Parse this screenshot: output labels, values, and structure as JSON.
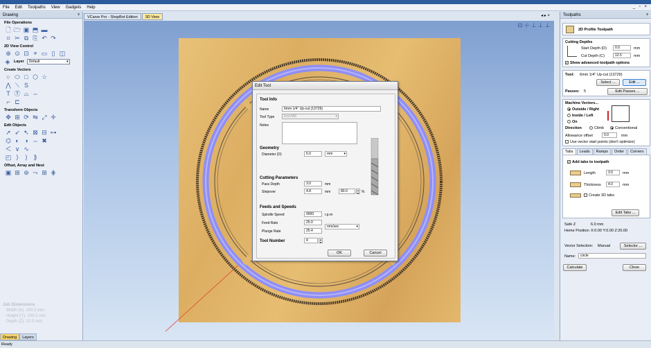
{
  "menu": [
    "File",
    "Edit",
    "Toolpaths",
    "View",
    "Gadgets",
    "Help"
  ],
  "window_controls": "_ ▫ ×",
  "left_panel": {
    "title": "Drawing",
    "pin": "ᵠ",
    "sections": {
      "file_operations": "File Operations",
      "view_control": "2D View Control",
      "create_vectors": "Create Vectors",
      "transform_objects": "Transform Objects",
      "edit_objects": "Edit Objects",
      "offset_array": "Offset, Array and Nest"
    },
    "layer_label": "Layer",
    "layer_value": "Default",
    "job_dimensions": {
      "title": "Job Dimensions",
      "width": "Width  (X): 100.0 mm",
      "height": "Height (Y): 100.0 mm",
      "depth": "Depth  (Z): 12.0 mm"
    },
    "tabs": [
      "Drawing",
      "Layers"
    ]
  },
  "doc_tabs": [
    "VCarve Pro - ShopBot Edition",
    "3D View"
  ],
  "doc_controls": "◂ ▸ ×",
  "dialog": {
    "title": "Edit Tool",
    "tool_info": "Tool Info",
    "name_label": "Name",
    "name_value": "6mm 1/4\" Up-cut (13729)",
    "tool_type_label": "Tool Type",
    "tool_type_value": "End Mill",
    "notes_label": "Notes",
    "geometry": "Geometry",
    "diameter_label": "Diameter (D)",
    "diameter_value": "6.0",
    "diameter_unit": "mm",
    "cutting_params": "Cutting Parameters",
    "pass_depth_label": "Pass Depth",
    "pass_depth_value": "3.0",
    "pass_depth_unit": "mm",
    "stepover_label": "Stepover",
    "stepover_value": "4.8",
    "stepover_unit": "mm",
    "stepover_pct": "80.0",
    "pct_sign": "%",
    "feeds_speeds": "Feeds and Speeds",
    "spindle_label": "Spindle Speed",
    "spindle_value": "9000",
    "spindle_unit": "r.p.m",
    "feed_label": "Feed Rate",
    "feed_value": "25.0",
    "rate_unit": "mm/sec",
    "plunge_label": "Plunge Rate",
    "plunge_value": "25.4",
    "tool_number_label": "Tool Number",
    "tool_number_value": "4",
    "ok": "OK",
    "cancel": "Cancel"
  },
  "right_panel": {
    "title": "Toolpaths",
    "pin": "ᵠ",
    "header": "2D Profile Toolpath",
    "cutting_depths": "Cutting Depths",
    "start_depth_label": "Start Depth (D)",
    "start_depth_value": "0.0",
    "cut_depth_label": "Cut Depth (C)",
    "cut_depth_value": "12.5",
    "unit_mm": "mm",
    "show_advanced": "Show advanced toolpath options",
    "tool_label": "Tool:",
    "tool_value": "6mm 1/4\" Up-cut (13729)",
    "select_btn": "Select ...",
    "edit_btn": "Edit ...",
    "passes_label": "Passes:",
    "passes_value": "5",
    "edit_passes_btn": "Edit Passes ...",
    "machine_vectors": "Machine Vectors...",
    "outside": "Outside / Right",
    "inside": "Inside / Left",
    "on": "On",
    "direction_label": "Direction",
    "climb": "Climb",
    "conventional": "Conventional",
    "allowance_label": "Allowance offset",
    "allowance_value": "0.0",
    "use_vector_start": "Use vector start points (don't optimize)",
    "tabs": [
      "Tabs",
      "Leads",
      "Ramps",
      "Order",
      "Corners"
    ],
    "add_tabs": "Add tabs to toolpath",
    "length_label": "Length",
    "length_value": "3.0",
    "thickness_label": "Thickness",
    "thickness_value": "4.0",
    "create_3d_tabs": "Create 3D tabs",
    "edit_tabs_btn": "Edit Tabs ...",
    "safe_z_label": "Safe Z",
    "safe_z_value": "6.0 mm",
    "home_label": "Home Position",
    "home_value": "X:0.00 Y:0.00 Z:20.00",
    "vector_sel_label": "Vector Selection:",
    "vector_sel_value": "Manual",
    "selector_btn": "Selector ...",
    "name_label": "Name:",
    "name_value": "circle",
    "calculate_btn": "Calculate",
    "close_btn": "Close"
  },
  "status": "Ready",
  "colors": {
    "accent": "#f7d46a",
    "ring_blue": "#8f8ef5",
    "wood": "#e0b46a",
    "toolpath_red": "#e04030"
  }
}
